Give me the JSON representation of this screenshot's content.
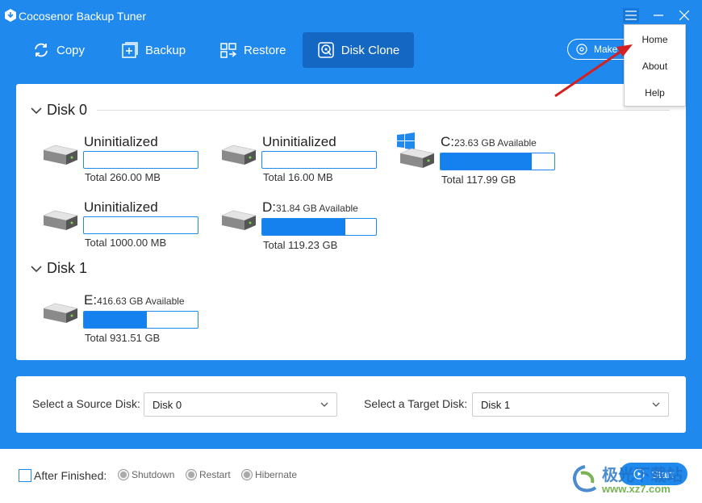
{
  "window": {
    "title": "Cocosenor Backup Tuner"
  },
  "toolbar": {
    "items": [
      {
        "label": "Copy",
        "icon": "sync-icon"
      },
      {
        "label": "Backup",
        "icon": "add-box-icon"
      },
      {
        "label": "Restore",
        "icon": "restore-icon"
      },
      {
        "label": "Disk Clone",
        "icon": "disk-clone-icon",
        "active": true
      }
    ],
    "make_label": "Make"
  },
  "menu": {
    "items": [
      "Home",
      "About",
      "Help"
    ]
  },
  "disks": [
    {
      "label": "Disk 0",
      "partitions": [
        {
          "name": "Uninitialized",
          "available": "",
          "total": "Total 260.00 MB",
          "used_fraction": 0
        },
        {
          "name": "Uninitialized",
          "available": "",
          "total": "Total 16.00 MB",
          "used_fraction": 0
        },
        {
          "name": "C:",
          "available": "23.63 GB Available",
          "total": "Total 117.99 GB",
          "used_fraction": 0.8,
          "system": true
        },
        {
          "name": "Uninitialized",
          "available": "",
          "total": "Total 1000.00 MB",
          "used_fraction": 0
        },
        {
          "name": "D:",
          "available": "31.84 GB Available",
          "total": "Total 119.23 GB",
          "used_fraction": 0.73
        }
      ]
    },
    {
      "label": "Disk 1",
      "partitions": [
        {
          "name": "E:",
          "available": "416.63 GB Available",
          "total": "Total 931.51 GB",
          "used_fraction": 0.55
        }
      ]
    }
  ],
  "selection": {
    "source_label": "Select a Source Disk:",
    "source_value": "Disk 0",
    "target_label": "Select a Target Disk:",
    "target_value": "Disk 1"
  },
  "footer": {
    "after_label": "After Finished:",
    "options": [
      "Shutdown",
      "Restart",
      "Hibernate"
    ],
    "start_label": "Start"
  },
  "watermark": {
    "line1": "极光下载站",
    "line2": "www.xz7.com"
  },
  "colors": {
    "accent": "#1f89ee",
    "active_tab": "#1567c4",
    "bar_fill": "#1581ee",
    "annotation_arrow": "#d42020"
  }
}
